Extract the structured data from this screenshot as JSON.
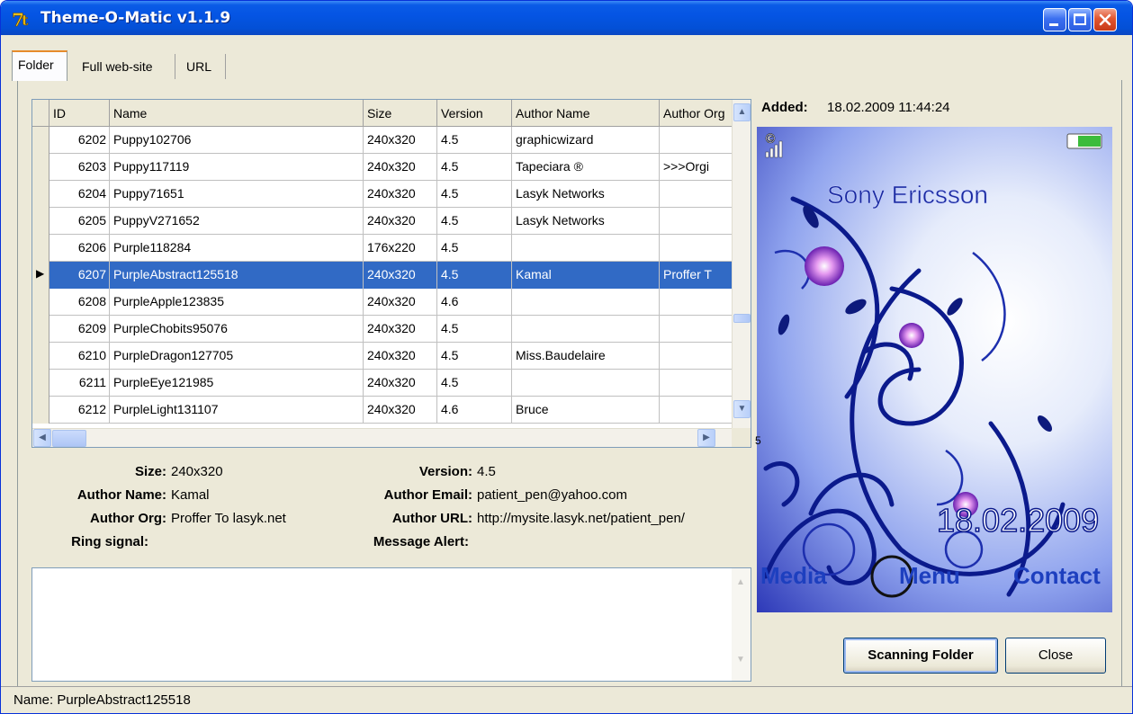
{
  "window": {
    "title": "Theme-O-Matic v1.1.9",
    "accent": "#0555e4"
  },
  "tabs": [
    {
      "label": "Folder",
      "active": true
    },
    {
      "label": "Full web-site",
      "active": false
    },
    {
      "label": "URL",
      "active": false
    }
  ],
  "grid": {
    "columns": [
      "ID",
      "Name",
      "Size",
      "Version",
      "Author Name",
      "Author Org"
    ],
    "rows": [
      {
        "id": "6202",
        "name": "Puppy102706",
        "size": "240x320",
        "version": "4.5",
        "author": "graphicwizard",
        "org": ""
      },
      {
        "id": "6203",
        "name": "Puppy117119",
        "size": "240x320",
        "version": "4.5",
        "author": "Tapeciara ®",
        "org": ">>>Orgi"
      },
      {
        "id": "6204",
        "name": "Puppy71651",
        "size": "240x320",
        "version": "4.5",
        "author": "Lasyk Networks",
        "org": ""
      },
      {
        "id": "6205",
        "name": "PuppyV271652",
        "size": "240x320",
        "version": "4.5",
        "author": "Lasyk Networks",
        "org": ""
      },
      {
        "id": "6206",
        "name": "Purple118284",
        "size": "176x220",
        "version": "4.5",
        "author": "",
        "org": ""
      },
      {
        "id": "6207",
        "name": "PurpleAbstract125518",
        "size": "240x320",
        "version": "4.5",
        "author": "Kamal",
        "org": "Proffer T"
      },
      {
        "id": "6208",
        "name": "PurpleApple123835",
        "size": "240x320",
        "version": "4.6",
        "author": "",
        "org": ""
      },
      {
        "id": "6209",
        "name": "PurpleChobits95076",
        "size": "240x320",
        "version": "4.5",
        "author": "",
        "org": ""
      },
      {
        "id": "6210",
        "name": "PurpleDragon127705",
        "size": "240x320",
        "version": "4.5",
        "author": "Miss.Baudelaire",
        "org": ""
      },
      {
        "id": "6211",
        "name": "PurpleEye121985",
        "size": "240x320",
        "version": "4.5",
        "author": "",
        "org": ""
      },
      {
        "id": "6212",
        "name": "PurpleLight131107",
        "size": "240x320",
        "version": "4.6",
        "author": "Bruce",
        "org": ""
      }
    ],
    "selected_index": 5,
    "selected_color": "#316ac5"
  },
  "details": {
    "size_label": "Size:",
    "size": "240x320",
    "author_name_label": "Author Name:",
    "author_name": "Kamal",
    "author_org_label": "Author Org:",
    "author_org": "Proffer To lasyk.net",
    "ring_label": "Ring signal:",
    "ring": "",
    "version_label": "Version:",
    "version": "4.5",
    "email_label": "Author Email:",
    "email": "patient_pen@yahoo.com",
    "url_label": "Author URL:",
    "url": "http://mysite.lasyk.net/patient_pen/",
    "message_label": "Message Alert:",
    "message": ""
  },
  "preview": {
    "added_label": "Added:",
    "added": "18.02.2009 11:44:24",
    "brand": "Sony Ericsson",
    "date": "18.02.2009",
    "soft_left": "Media",
    "soft_center": "Menu",
    "soft_right": "Contact",
    "side_number": "5"
  },
  "buttons": {
    "scan": "Scanning Folder",
    "close": "Close"
  },
  "status": {
    "text": "Name: PurpleAbstract125518"
  }
}
